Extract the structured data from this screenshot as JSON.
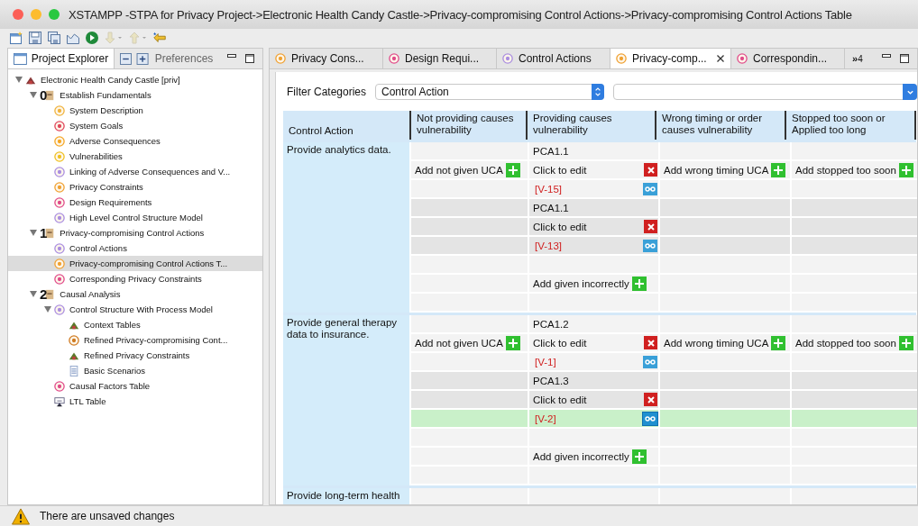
{
  "window": {
    "title": "XSTAMPP -STPA for Privacy Project->Electronic Health Candy Castle->Privacy-compromising Control Actions->Privacy-compromising Control Actions Table"
  },
  "explorer": {
    "tabs": [
      {
        "label": "Project Explorer",
        "selected": true
      },
      {
        "label": "Preferences",
        "selected": false
      }
    ],
    "tree": [
      {
        "label": "Electronic Health Candy Castle [priv]",
        "expanded": true,
        "selected": false,
        "children": [
          {
            "label": "Establish Fundamentals",
            "badge": "0",
            "expanded": true,
            "selected": false,
            "children": [
              {
                "label": "System Description",
                "selected": false
              },
              {
                "label": "System Goals",
                "selected": false
              },
              {
                "label": "Adverse Consequences",
                "selected": false
              },
              {
                "label": "Vulnerabilities",
                "selected": false
              },
              {
                "label": "Linking of Adverse Consequences and V...",
                "selected": false
              },
              {
                "label": "Privacy Constraints",
                "selected": false
              },
              {
                "label": "Design Requirements",
                "selected": false
              },
              {
                "label": "High Level Control Structure Model",
                "selected": false
              }
            ]
          },
          {
            "label": "Privacy-compromising Control Actions",
            "badge": "1",
            "expanded": true,
            "selected": false,
            "children": [
              {
                "label": "Control Actions",
                "selected": false
              },
              {
                "label": "Privacy-compromising Control Actions T...",
                "selected": true
              },
              {
                "label": "Corresponding Privacy Constraints",
                "selected": false
              }
            ]
          },
          {
            "label": "Causal Analysis",
            "badge": "2",
            "expanded": true,
            "selected": false,
            "children": [
              {
                "label": "Control Structure With Process Model",
                "expanded": true,
                "selected": false,
                "children": [
                  {
                    "label": "Context Tables",
                    "selected": false
                  },
                  {
                    "label": "Refined Privacy-compromising Cont...",
                    "selected": false
                  },
                  {
                    "label": "Refined Privacy Constraints",
                    "selected": false
                  },
                  {
                    "label": "Basic Scenarios",
                    "selected": false
                  }
                ]
              },
              {
                "label": "Causal Factors Table",
                "selected": false
              },
              {
                "label": "LTL Table",
                "selected": false
              }
            ]
          }
        ]
      }
    ]
  },
  "editor": {
    "tabs": [
      {
        "label": "Privacy Cons...",
        "selected": false
      },
      {
        "label": "Design Requi...",
        "selected": false
      },
      {
        "label": "Control Actions",
        "selected": false
      },
      {
        "label": "Privacy-comp...",
        "selected": true
      },
      {
        "label": "Correspondin...",
        "selected": false
      }
    ],
    "overflow": {
      "glyph": "»",
      "count": "4"
    },
    "filter": {
      "label": "Filter Categories",
      "category": "Control Action"
    },
    "columns": [
      "Control Action",
      "Not providing causes vulnerability",
      "Providing causes vulnerability",
      "Wrong timing or order causes vulnerability",
      "Stopped too soon or Applied too long"
    ],
    "rows": [
      {
        "control_action": "Provide analytics data.",
        "add_not_given": "Add not given UCA",
        "add_wrong_timing": "Add wrong timing UCA",
        "add_stopped": "Add stopped too soon",
        "add_given": "Add given incorrectly",
        "ucas": [
          {
            "id": "PCA1.1",
            "text": "Click to edit",
            "link": "[V-15]",
            "selected": false
          },
          {
            "id": "PCA1.1",
            "text": "Click to edit",
            "link": "[V-13]",
            "selected": false
          }
        ]
      },
      {
        "control_action": "Provide general therapy data to insurance.",
        "add_not_given": "Add not given UCA",
        "add_wrong_timing": "Add wrong timing UCA",
        "add_stopped": "Add stopped too soon",
        "add_given": "Add given incorrectly",
        "ucas": [
          {
            "id": "PCA1.2",
            "text": "Click to edit",
            "link": "[V-1]",
            "selected": false
          },
          {
            "id": "PCA1.3",
            "text": "Click to edit",
            "link": "[V-2]",
            "selected": true
          }
        ]
      },
      {
        "control_action": "Provide long-term health"
      }
    ]
  },
  "status_bar": {
    "message": "There are unsaved changes"
  }
}
